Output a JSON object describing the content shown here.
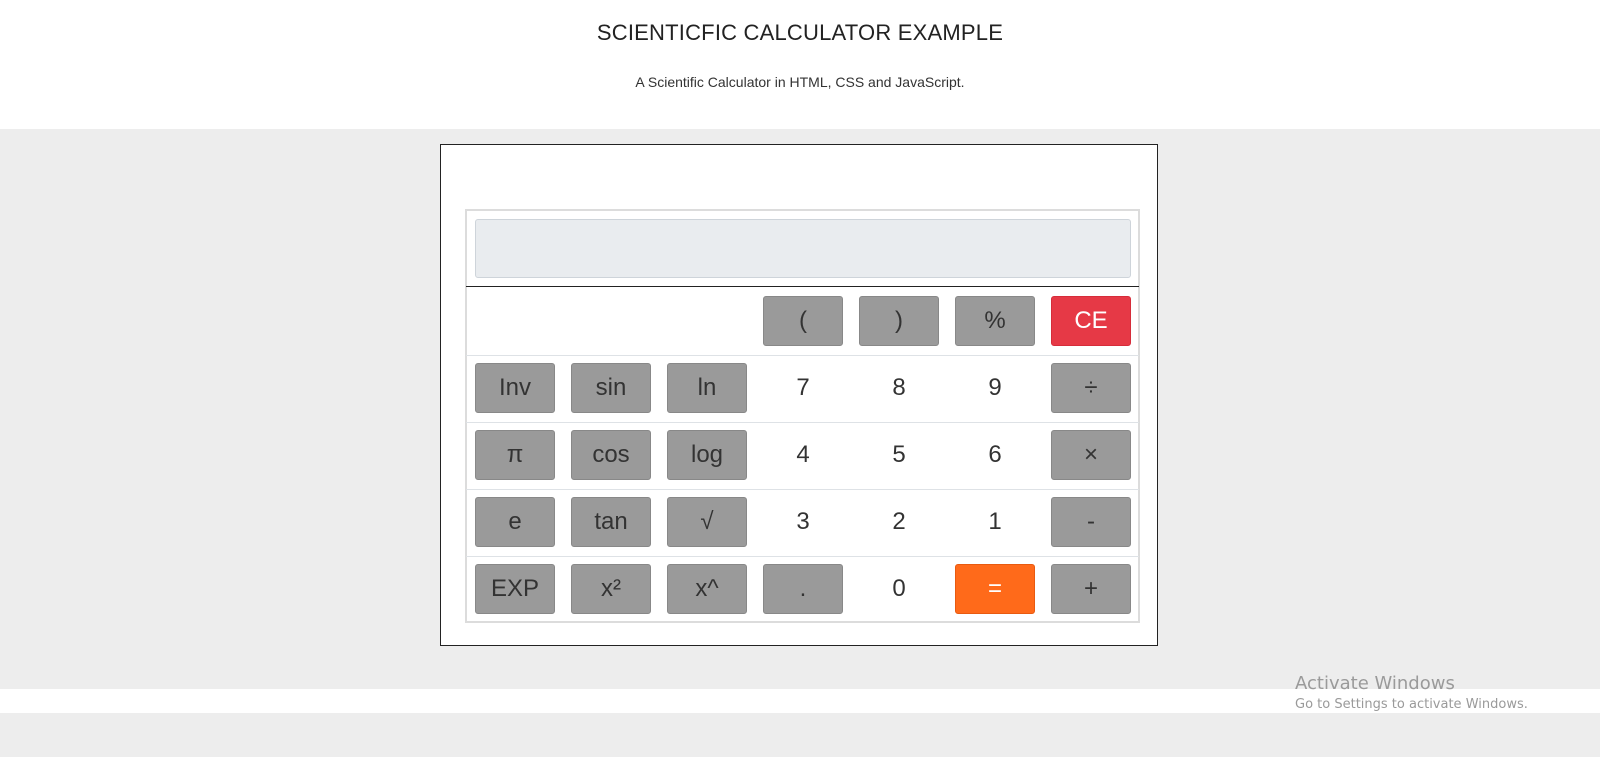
{
  "header": {
    "title": "SCIENTICFIC CALCULATOR EXAMPLE",
    "subtitle": "A Scientific Calculator in HTML, CSS and JavaScript."
  },
  "calculator": {
    "display_value": "",
    "keys": {
      "open_paren": "(",
      "close_paren": ")",
      "percent": "%",
      "clear": "CE",
      "inv": "Inv",
      "sin": "sin",
      "ln": "ln",
      "seven": "7",
      "eight": "8",
      "nine": "9",
      "divide": "÷",
      "pi": "π",
      "cos": "cos",
      "log": "log",
      "four": "4",
      "five": "5",
      "six": "6",
      "multiply": "×",
      "e": "e",
      "tan": "tan",
      "sqrt": "√",
      "three": "3",
      "two": "2",
      "one": "1",
      "minus": "-",
      "exp": "EXP",
      "square": "x²",
      "power": "x^",
      "decimal": ".",
      "zero": "0",
      "equals": "=",
      "plus": "+"
    }
  },
  "watermark": {
    "title": "Activate Windows",
    "subtitle": "Go to Settings to activate Windows."
  },
  "colors": {
    "key_gray": "#9a9a9a",
    "clear_red": "#e63946",
    "equals_orange": "#ff6a1a",
    "display_bg": "#e9ecef",
    "band_gray": "#ededed"
  }
}
